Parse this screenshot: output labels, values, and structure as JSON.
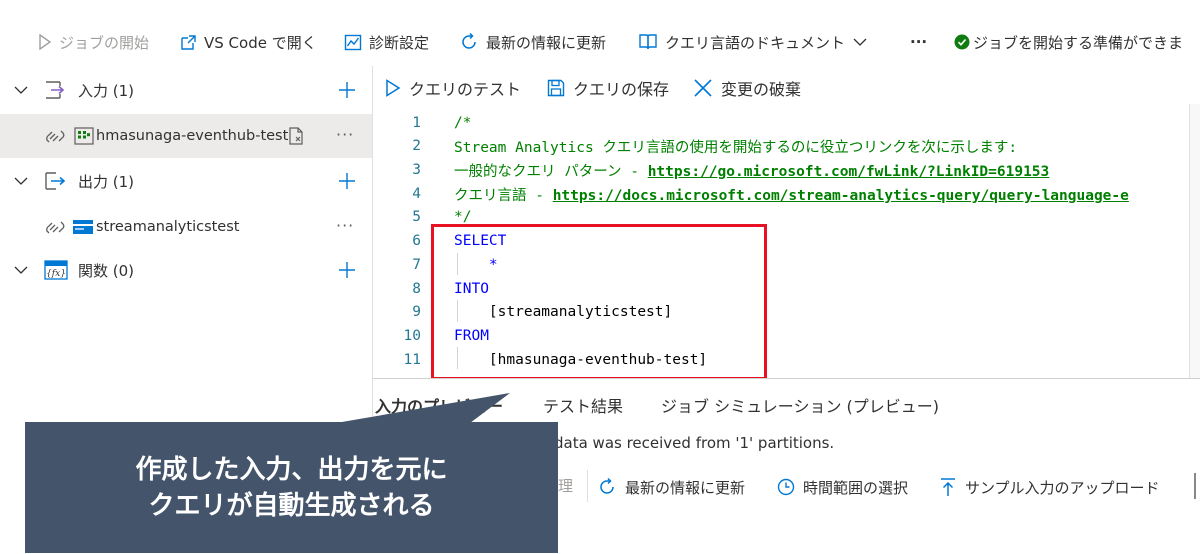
{
  "toolbar": {
    "start_job": "ジョブの開始",
    "open_vscode": "VS Code で開く",
    "diagnostics": "診断設定",
    "refresh": "最新の情報に更新",
    "docs": "クエリ言語のドキュメント",
    "more": "···",
    "status": "ジョブを開始する準備ができま"
  },
  "sidebar": {
    "input_group": "入力 (1)",
    "input_item": "hmasunaga-eventhub-test",
    "output_group": "出力 (1)",
    "output_item": "streamanalyticstest",
    "function_group": "関数 (0)",
    "item_more": "···"
  },
  "query_toolbar": {
    "test": "クエリのテスト",
    "save": "クエリの保存",
    "discard": "変更の破棄"
  },
  "editor": {
    "lines": [
      {
        "n": "1",
        "text": "/*"
      },
      {
        "n": "2",
        "text": "Stream Analytics クエリ言語の使用を開始するのに役立つリンクを次に示します:"
      },
      {
        "n": "3",
        "prefix": "一般的なクエリ パターン - ",
        "url": "https://go.microsoft.com/fwLink/?LinkID=619153"
      },
      {
        "n": "4",
        "prefix": "クエリ言語 - ",
        "url": "https://docs.microsoft.com/stream-analytics-query/query-language-e"
      },
      {
        "n": "5",
        "text": "*/"
      },
      {
        "n": "6",
        "text": "SELECT"
      },
      {
        "n": "7",
        "text": "    *"
      },
      {
        "n": "8",
        "text": "INTO"
      },
      {
        "n": "9",
        "text": "    [streamanalyticstest]"
      },
      {
        "n": "10",
        "text": "FROM"
      },
      {
        "n": "11",
        "text": "    [hmasunaga-eventhub-test]"
      }
    ]
  },
  "bottom": {
    "tab_preview": "入力のプレビュー",
    "tab_results": "テスト結果",
    "tab_simulation": "ジョブ シミュレーション (プレビュー)",
    "info": "data was received from '1' partitions.",
    "partial_label": "理",
    "refresh": "最新の情報に更新",
    "time_range": "時間範囲の選択",
    "upload": "サンプル入力のアップロード"
  },
  "callout": {
    "line1": "作成した入力、出力を元に",
    "line2": "クエリが自動生成される"
  },
  "colors": {
    "accent": "#0078d4",
    "highlight_box": "#e81123",
    "callout_bg": "#44546a",
    "status_ok": "#107c10"
  }
}
